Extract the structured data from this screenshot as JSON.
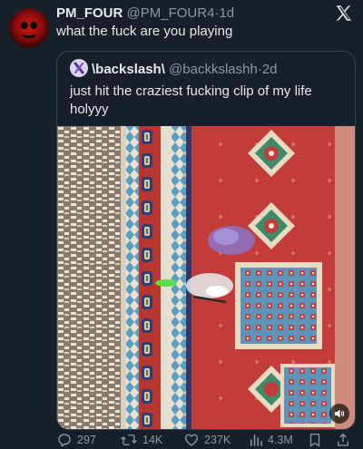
{
  "tweet": {
    "name": "PM_FOUR",
    "handle": "@PM_FOUR4",
    "dot": "·",
    "time": "1d",
    "text": "what the fuck are you playing"
  },
  "quote": {
    "name": "\\backslash\\",
    "handle": "@backkslashh",
    "dot": "·",
    "time": "2d",
    "text": "just hit the craziest fucking clip of my life holyyy"
  },
  "actions": {
    "replies": "297",
    "reposts": "14K",
    "likes": "237K",
    "views": "4.3M"
  },
  "icons": {
    "logo": "x-logo-icon",
    "reply": "reply-icon",
    "repost": "repost-icon",
    "like": "heart-icon",
    "views": "views-icon",
    "bookmark": "bookmark-icon",
    "share": "share-icon",
    "mute": "volume-icon"
  },
  "colors": {
    "background": "#15202b",
    "secondary_text": "#8b98a5",
    "border": "#38444d"
  }
}
